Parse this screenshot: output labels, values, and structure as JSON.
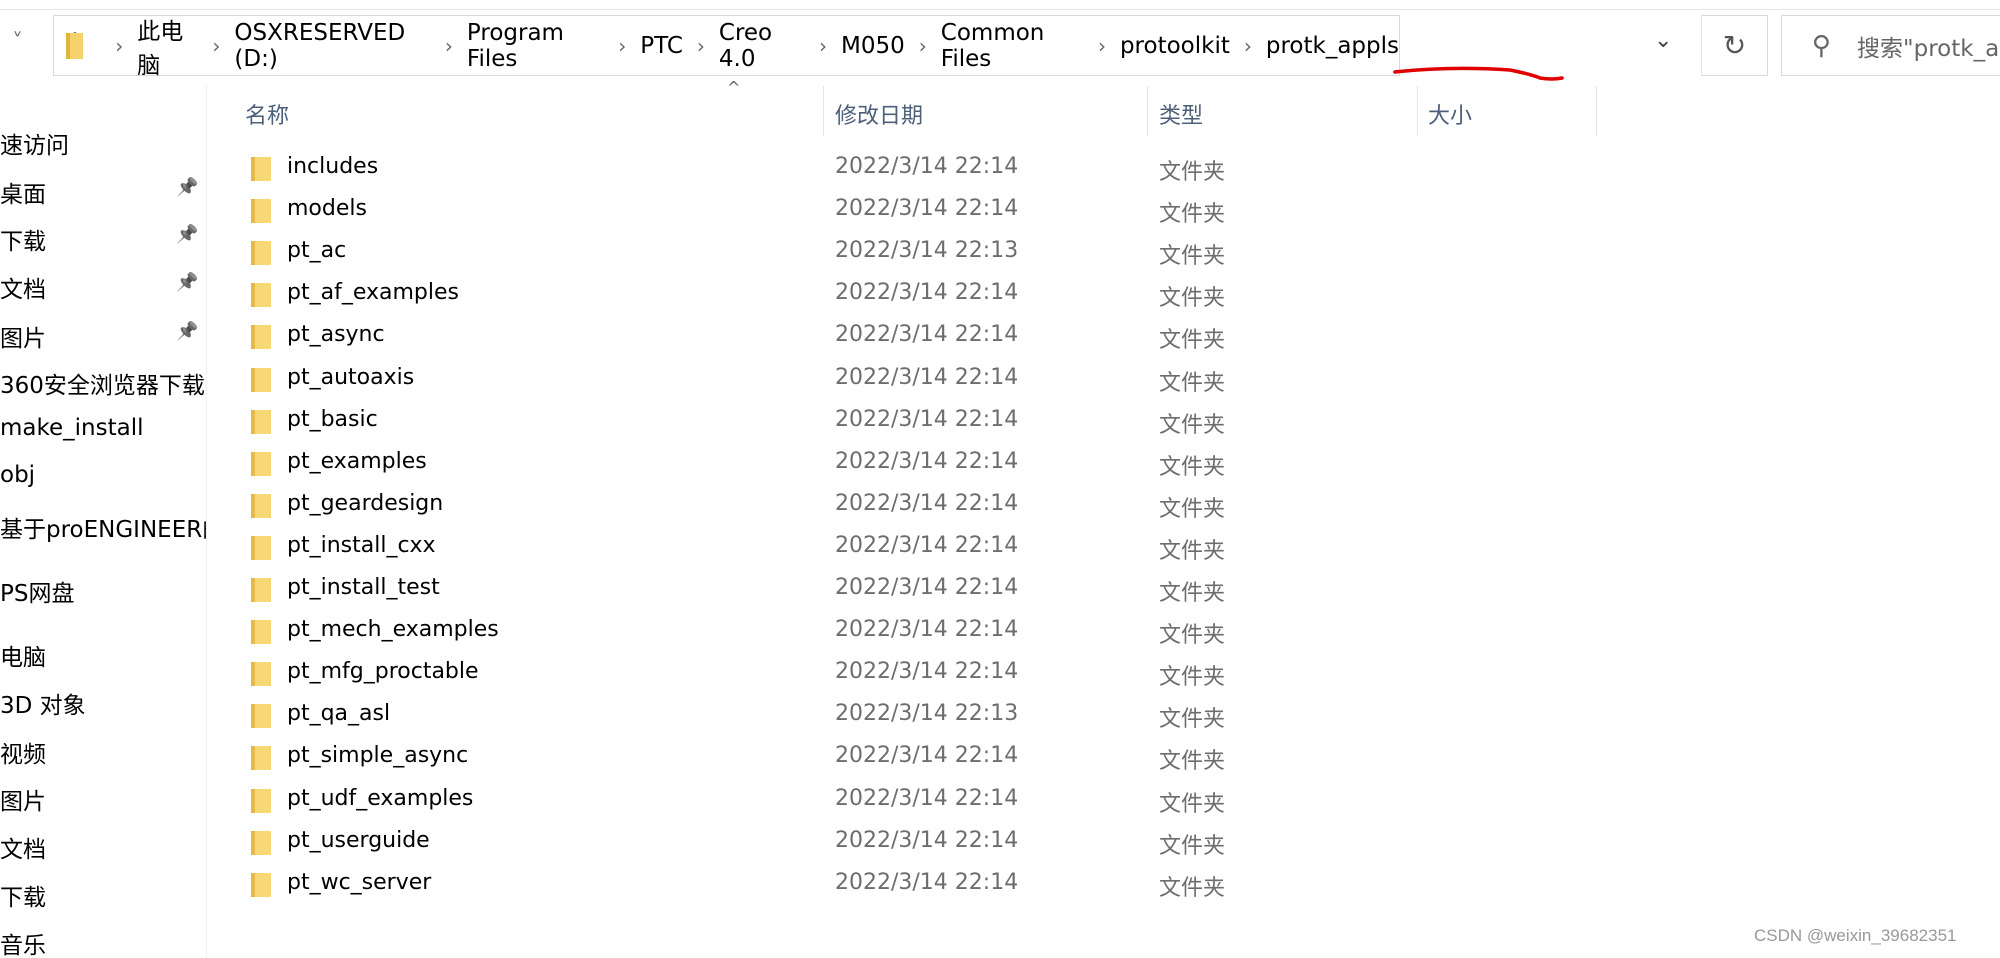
{
  "breadcrumb": [
    "此电脑",
    "OSXRESERVED (D:)",
    "Program Files",
    "PTC",
    "Creo 4.0",
    "M050",
    "Common Files",
    "protoolkit",
    "protk_appls"
  ],
  "search": {
    "placeholder": "搜索\"protk_appls\""
  },
  "icons": {
    "back": "chevron-down-icon",
    "up": "up-arrow-icon",
    "refresh": "refresh-icon",
    "search": "search-icon",
    "folder": "folder-icon",
    "pin": "pin-icon"
  },
  "sidebar": [
    {
      "label": "速访问"
    },
    {
      "label": "桌面",
      "pinned": true
    },
    {
      "label": "下载",
      "pinned": true
    },
    {
      "label": "文档",
      "pinned": true
    },
    {
      "label": "图片",
      "pinned": true
    },
    {
      "label": "360安全浏览器下载"
    },
    {
      "label": "make_install"
    },
    {
      "label": "obj"
    },
    {
      "label": "基于proENGINEER的"
    },
    {
      "label": "PS网盘"
    },
    {
      "label": "电脑"
    },
    {
      "label": "3D 对象"
    },
    {
      "label": "视频"
    },
    {
      "label": "图片"
    },
    {
      "label": "文档"
    },
    {
      "label": "下载"
    },
    {
      "label": "音乐"
    }
  ],
  "columns": {
    "name": "名称",
    "date": "修改日期",
    "type": "类型",
    "size": "大小"
  },
  "files": [
    {
      "name": "includes",
      "date": "2022/3/14 22:14",
      "type": "文件夹"
    },
    {
      "name": "models",
      "date": "2022/3/14 22:14",
      "type": "文件夹"
    },
    {
      "name": "pt_ac",
      "date": "2022/3/14 22:13",
      "type": "文件夹"
    },
    {
      "name": "pt_af_examples",
      "date": "2022/3/14 22:14",
      "type": "文件夹"
    },
    {
      "name": "pt_async",
      "date": "2022/3/14 22:14",
      "type": "文件夹"
    },
    {
      "name": "pt_autoaxis",
      "date": "2022/3/14 22:14",
      "type": "文件夹"
    },
    {
      "name": "pt_basic",
      "date": "2022/3/14 22:14",
      "type": "文件夹"
    },
    {
      "name": "pt_examples",
      "date": "2022/3/14 22:14",
      "type": "文件夹"
    },
    {
      "name": "pt_geardesign",
      "date": "2022/3/14 22:14",
      "type": "文件夹"
    },
    {
      "name": "pt_install_cxx",
      "date": "2022/3/14 22:14",
      "type": "文件夹"
    },
    {
      "name": "pt_install_test",
      "date": "2022/3/14 22:14",
      "type": "文件夹"
    },
    {
      "name": "pt_mech_examples",
      "date": "2022/3/14 22:14",
      "type": "文件夹"
    },
    {
      "name": "pt_mfg_proctable",
      "date": "2022/3/14 22:14",
      "type": "文件夹"
    },
    {
      "name": "pt_qa_asl",
      "date": "2022/3/14 22:13",
      "type": "文件夹"
    },
    {
      "name": "pt_simple_async",
      "date": "2022/3/14 22:14",
      "type": "文件夹"
    },
    {
      "name": "pt_udf_examples",
      "date": "2022/3/14 22:14",
      "type": "文件夹"
    },
    {
      "name": "pt_userguide",
      "date": "2022/3/14 22:14",
      "type": "文件夹"
    },
    {
      "name": "pt_wc_server",
      "date": "2022/3/14 22:14",
      "type": "文件夹"
    }
  ],
  "annotation_color": "#e00000",
  "watermark": "CSDN @weixin_39682351"
}
